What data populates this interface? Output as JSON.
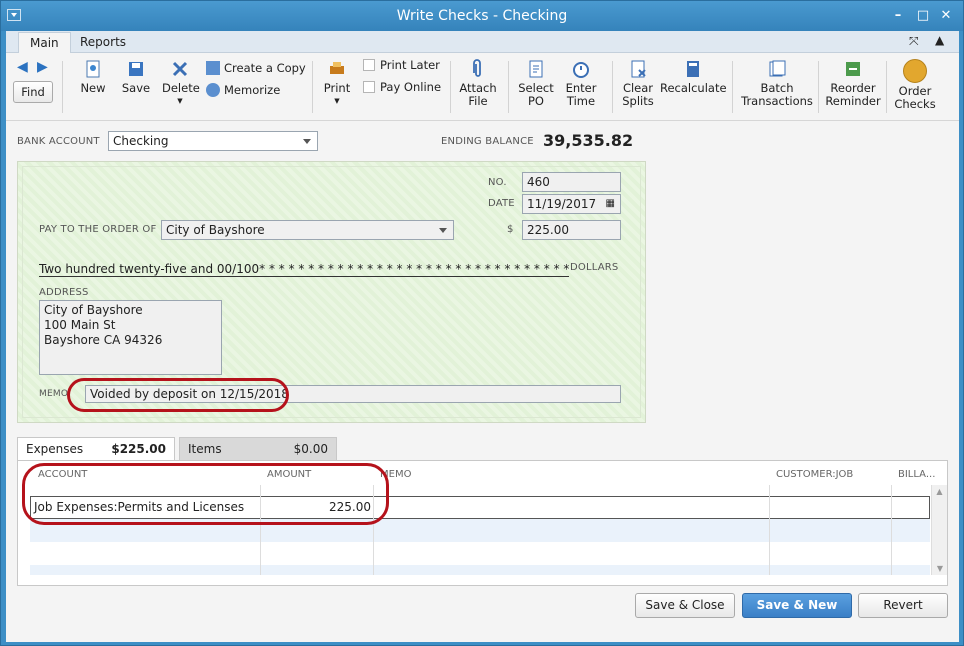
{
  "window": {
    "title": "Write Checks - Checking"
  },
  "ribbon_tabs": [
    "Main",
    "Reports"
  ],
  "toolbar": {
    "find": "Find",
    "new": "New",
    "save": "Save",
    "delete": "Delete",
    "create_copy": "Create a Copy",
    "memorize": "Memorize",
    "print": "Print",
    "print_later": "Print Later",
    "pay_online": "Pay Online",
    "attach_file": [
      "Attach",
      "File"
    ],
    "select_po": [
      "Select",
      "PO"
    ],
    "enter_time": [
      "Enter",
      "Time"
    ],
    "clear_splits": [
      "Clear",
      "Splits"
    ],
    "recalculate": "Recalculate",
    "batch": [
      "Batch",
      "Transactions"
    ],
    "reorder": [
      "Reorder",
      "Reminder"
    ],
    "order_checks": [
      "Order",
      "Checks"
    ]
  },
  "bank": {
    "label": "BANK ACCOUNT",
    "value": "Checking",
    "ending_label": "ENDING BALANCE",
    "ending_value": "39,535.82"
  },
  "check": {
    "no_label": "NO.",
    "no": "460",
    "date_label": "DATE",
    "date": "11/19/2017",
    "payto_label": "PAY TO THE ORDER OF",
    "payee": "City of Bayshore",
    "dollar_sign": "$",
    "amount": "225.00",
    "amount_words": "Two hundred twenty-five and 00/100* * * * * * * * * * * * * * * * * * * * * * * * * * * * * * * * * * * * * * * * * *",
    "dollars_label": "DOLLARS",
    "address_label": "ADDRESS",
    "address": [
      "City of Bayshore",
      "100 Main St",
      "Bayshore CA 94326"
    ],
    "memo_label": "MEMO",
    "memo": "Voided by deposit on 12/15/2018"
  },
  "tabs": {
    "expenses_label": "Expenses",
    "expenses_amount": "$225.00",
    "items_label": "Items",
    "items_amount": "$0.00"
  },
  "grid": {
    "headers": [
      "ACCOUNT",
      "AMOUNT",
      "MEMO",
      "CUSTOMER:JOB",
      "BILLA..."
    ],
    "rows": [
      {
        "account": "Job Expenses:Permits and Licenses",
        "amount": "225.00"
      }
    ]
  },
  "buttons": {
    "save_close": "Save & Close",
    "save_new": "Save & New",
    "revert": "Revert"
  }
}
